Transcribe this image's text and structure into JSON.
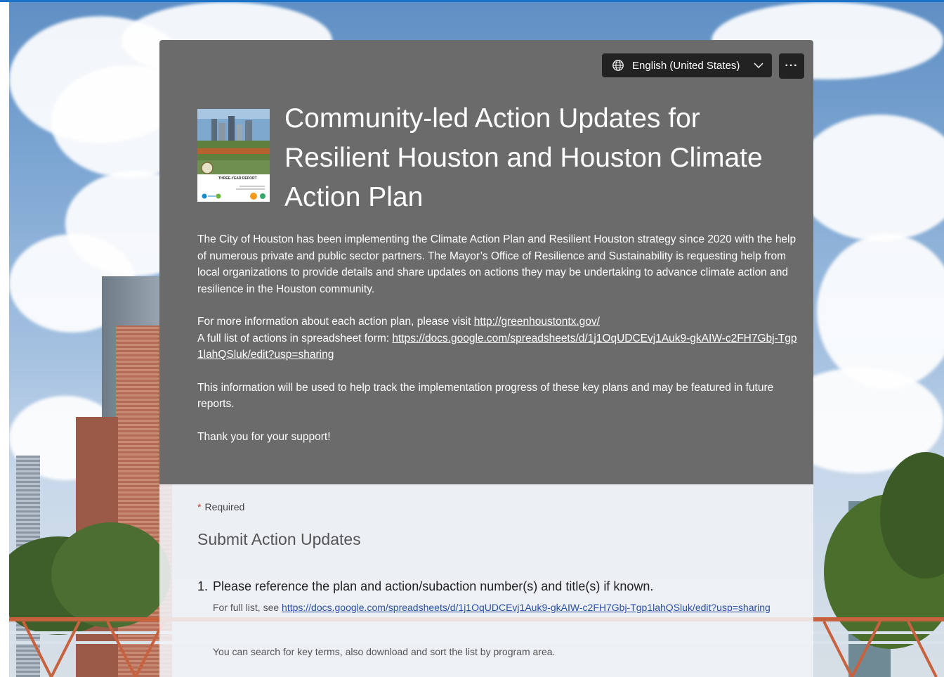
{
  "form": {
    "language_selector": {
      "label": "English (United States)"
    },
    "more_options": {
      "label": "···"
    },
    "cover_image": {
      "alt": "THREE-YEAR REPORT",
      "caption": "THREE-YEAR REPORT"
    },
    "title": "Community-led Action Updates for Resilient Houston and Houston Climate Action Plan",
    "description": {
      "paragraph1": "The City of Houston has been implementing the Climate Action Plan and Resilient Houston strategy since 2020 with the help of numerous private and public sector partners. The Mayor’s Office of Resilience and Sustainability is requesting help from local organizations to provide details and share updates on actions they may be undertaking to advance climate action and resilience in the Houston community.",
      "more_info_prefix": "For more information about each action plan, please visit ",
      "more_info_link": "http://greenhoustontx.gov/",
      "spreadsheet_prefix": "A full list of actions in spreadsheet form: ",
      "spreadsheet_link": "https://docs.google.com/spreadsheets/d/1j1OqUDCEvj1Auk9-gkAIW-c2FH7Gbj-Tgp1lahQSluk/edit?usp=sharing",
      "paragraph3": "This information will be used to help track the implementation progress of these key plans and may be featured in future reports.",
      "paragraph4": "Thank you for your support!"
    },
    "required_label": "Required",
    "required_marker": "*",
    "section_title": "Submit Action Updates",
    "questions": [
      {
        "number": "1.",
        "text": "Please reference the plan and action/subaction number(s) and title(s) if known.",
        "subtitle_prefix": "For full list, see ",
        "subtitle_link": "https://docs.google.com/spreadsheets/d/1j1OqUDCEvj1Auk9-gkAIW-c2FH7Gbj-Tgp1lahQSluk/edit?usp=sharing",
        "note": "You can search for key terms, also download and sort the list by program area."
      }
    ]
  },
  "colors": {
    "header_bg": "#6b6b6b",
    "button_bg": "#222222",
    "link_in_body": "#2a4fa8",
    "accent_bar": "#1a73c9"
  }
}
